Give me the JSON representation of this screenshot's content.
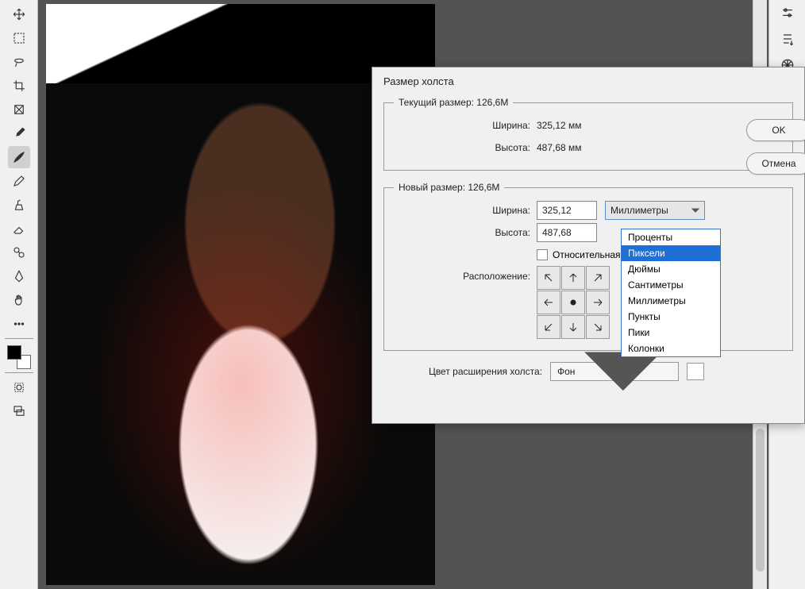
{
  "dialog": {
    "title": "Размер холста",
    "current": {
      "legend": "Текущий размер:  126,6M",
      "width_label": "Ширина:",
      "width_val": "325,12 мм",
      "height_label": "Высота:",
      "height_val": "487,68 мм"
    },
    "new": {
      "legend": "Новый размер: 126,6M",
      "width_label": "Ширина:",
      "width_val": "325,12",
      "height_label": "Высота:",
      "height_val": "487,68",
      "unit_selected": "Миллиметры",
      "relative_label": "Относительная",
      "anchor_label": "Расположение:"
    },
    "extension_label": "Цвет расширения холста:",
    "extension_value": "Фон",
    "ok": "OK",
    "cancel": "Отмена",
    "unit_options": [
      "Проценты",
      "Пиксели",
      "Дюймы",
      "Сантиметры",
      "Миллиметры",
      "Пункты",
      "Пики",
      "Колонки"
    ],
    "unit_highlighted": "Пиксели"
  }
}
